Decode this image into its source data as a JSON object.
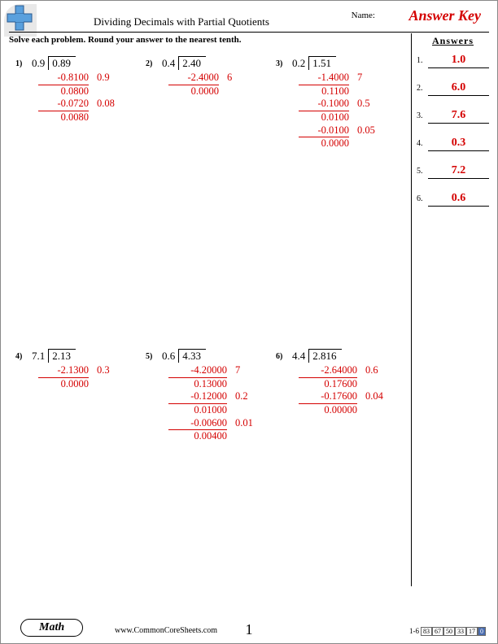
{
  "header": {
    "title": "Dividing Decimals with Partial Quotients",
    "name_label": "Name:",
    "key_label": "Answer Key"
  },
  "instructions": "Solve each problem. Round your answer to the nearest tenth.",
  "answers_title": "Answers",
  "answers": [
    {
      "n": "1.",
      "v": "1.0"
    },
    {
      "n": "2.",
      "v": "6.0"
    },
    {
      "n": "3.",
      "v": "7.6"
    },
    {
      "n": "4.",
      "v": "0.3"
    },
    {
      "n": "5.",
      "v": "7.2"
    },
    {
      "n": "6.",
      "v": "0.6"
    }
  ],
  "problems": [
    {
      "num": "1)",
      "divisor": "0.9",
      "dividend": "0.89",
      "steps": [
        {
          "a": "-0.8100",
          "q": "0.9"
        },
        {
          "rule": true
        },
        {
          "a": "0.0800"
        },
        {
          "a": "-0.0720",
          "q": "0.08"
        },
        {
          "rule": true
        },
        {
          "a": "0.0080"
        }
      ]
    },
    {
      "num": "2)",
      "divisor": "0.4",
      "dividend": "2.40",
      "steps": [
        {
          "a": "-2.4000",
          "q": "6"
        },
        {
          "rule": true
        },
        {
          "a": "0.0000"
        }
      ]
    },
    {
      "num": "3)",
      "divisor": "0.2",
      "dividend": "1.51",
      "steps": [
        {
          "a": "-1.4000",
          "q": "7"
        },
        {
          "rule": true
        },
        {
          "a": "0.1100"
        },
        {
          "a": "-0.1000",
          "q": "0.5"
        },
        {
          "rule": true
        },
        {
          "a": "0.0100"
        },
        {
          "a": "-0.0100",
          "q": "0.05"
        },
        {
          "rule": true
        },
        {
          "a": "0.0000"
        }
      ]
    },
    {
      "num": "4)",
      "divisor": "7.1",
      "dividend": "2.13",
      "steps": [
        {
          "a": "-2.1300",
          "q": "0.3"
        },
        {
          "rule": true
        },
        {
          "a": "0.0000"
        }
      ]
    },
    {
      "num": "5)",
      "divisor": "0.6",
      "dividend": "4.33",
      "wide": true,
      "steps": [
        {
          "a": "-4.20000",
          "q": "7"
        },
        {
          "rule": true
        },
        {
          "a": "0.13000"
        },
        {
          "a": "-0.12000",
          "q": "0.2"
        },
        {
          "rule": true
        },
        {
          "a": "0.01000"
        },
        {
          "a": "-0.00600",
          "q": "0.01"
        },
        {
          "rule": true
        },
        {
          "a": "0.00400"
        }
      ]
    },
    {
      "num": "6)",
      "divisor": "4.4",
      "dividend": "2.816",
      "wide": true,
      "steps": [
        {
          "a": "-2.64000",
          "q": "0.6"
        },
        {
          "rule": true
        },
        {
          "a": "0.17600"
        },
        {
          "a": "-0.17600",
          "q": "0.04"
        },
        {
          "rule": true
        },
        {
          "a": "0.00000"
        }
      ]
    }
  ],
  "footer": {
    "badge": "Math",
    "url": "www.CommonCoreSheets.com",
    "page": "1",
    "score_label": "1-6",
    "score_cells": [
      "83",
      "67",
      "50",
      "33",
      "17",
      "0"
    ]
  }
}
